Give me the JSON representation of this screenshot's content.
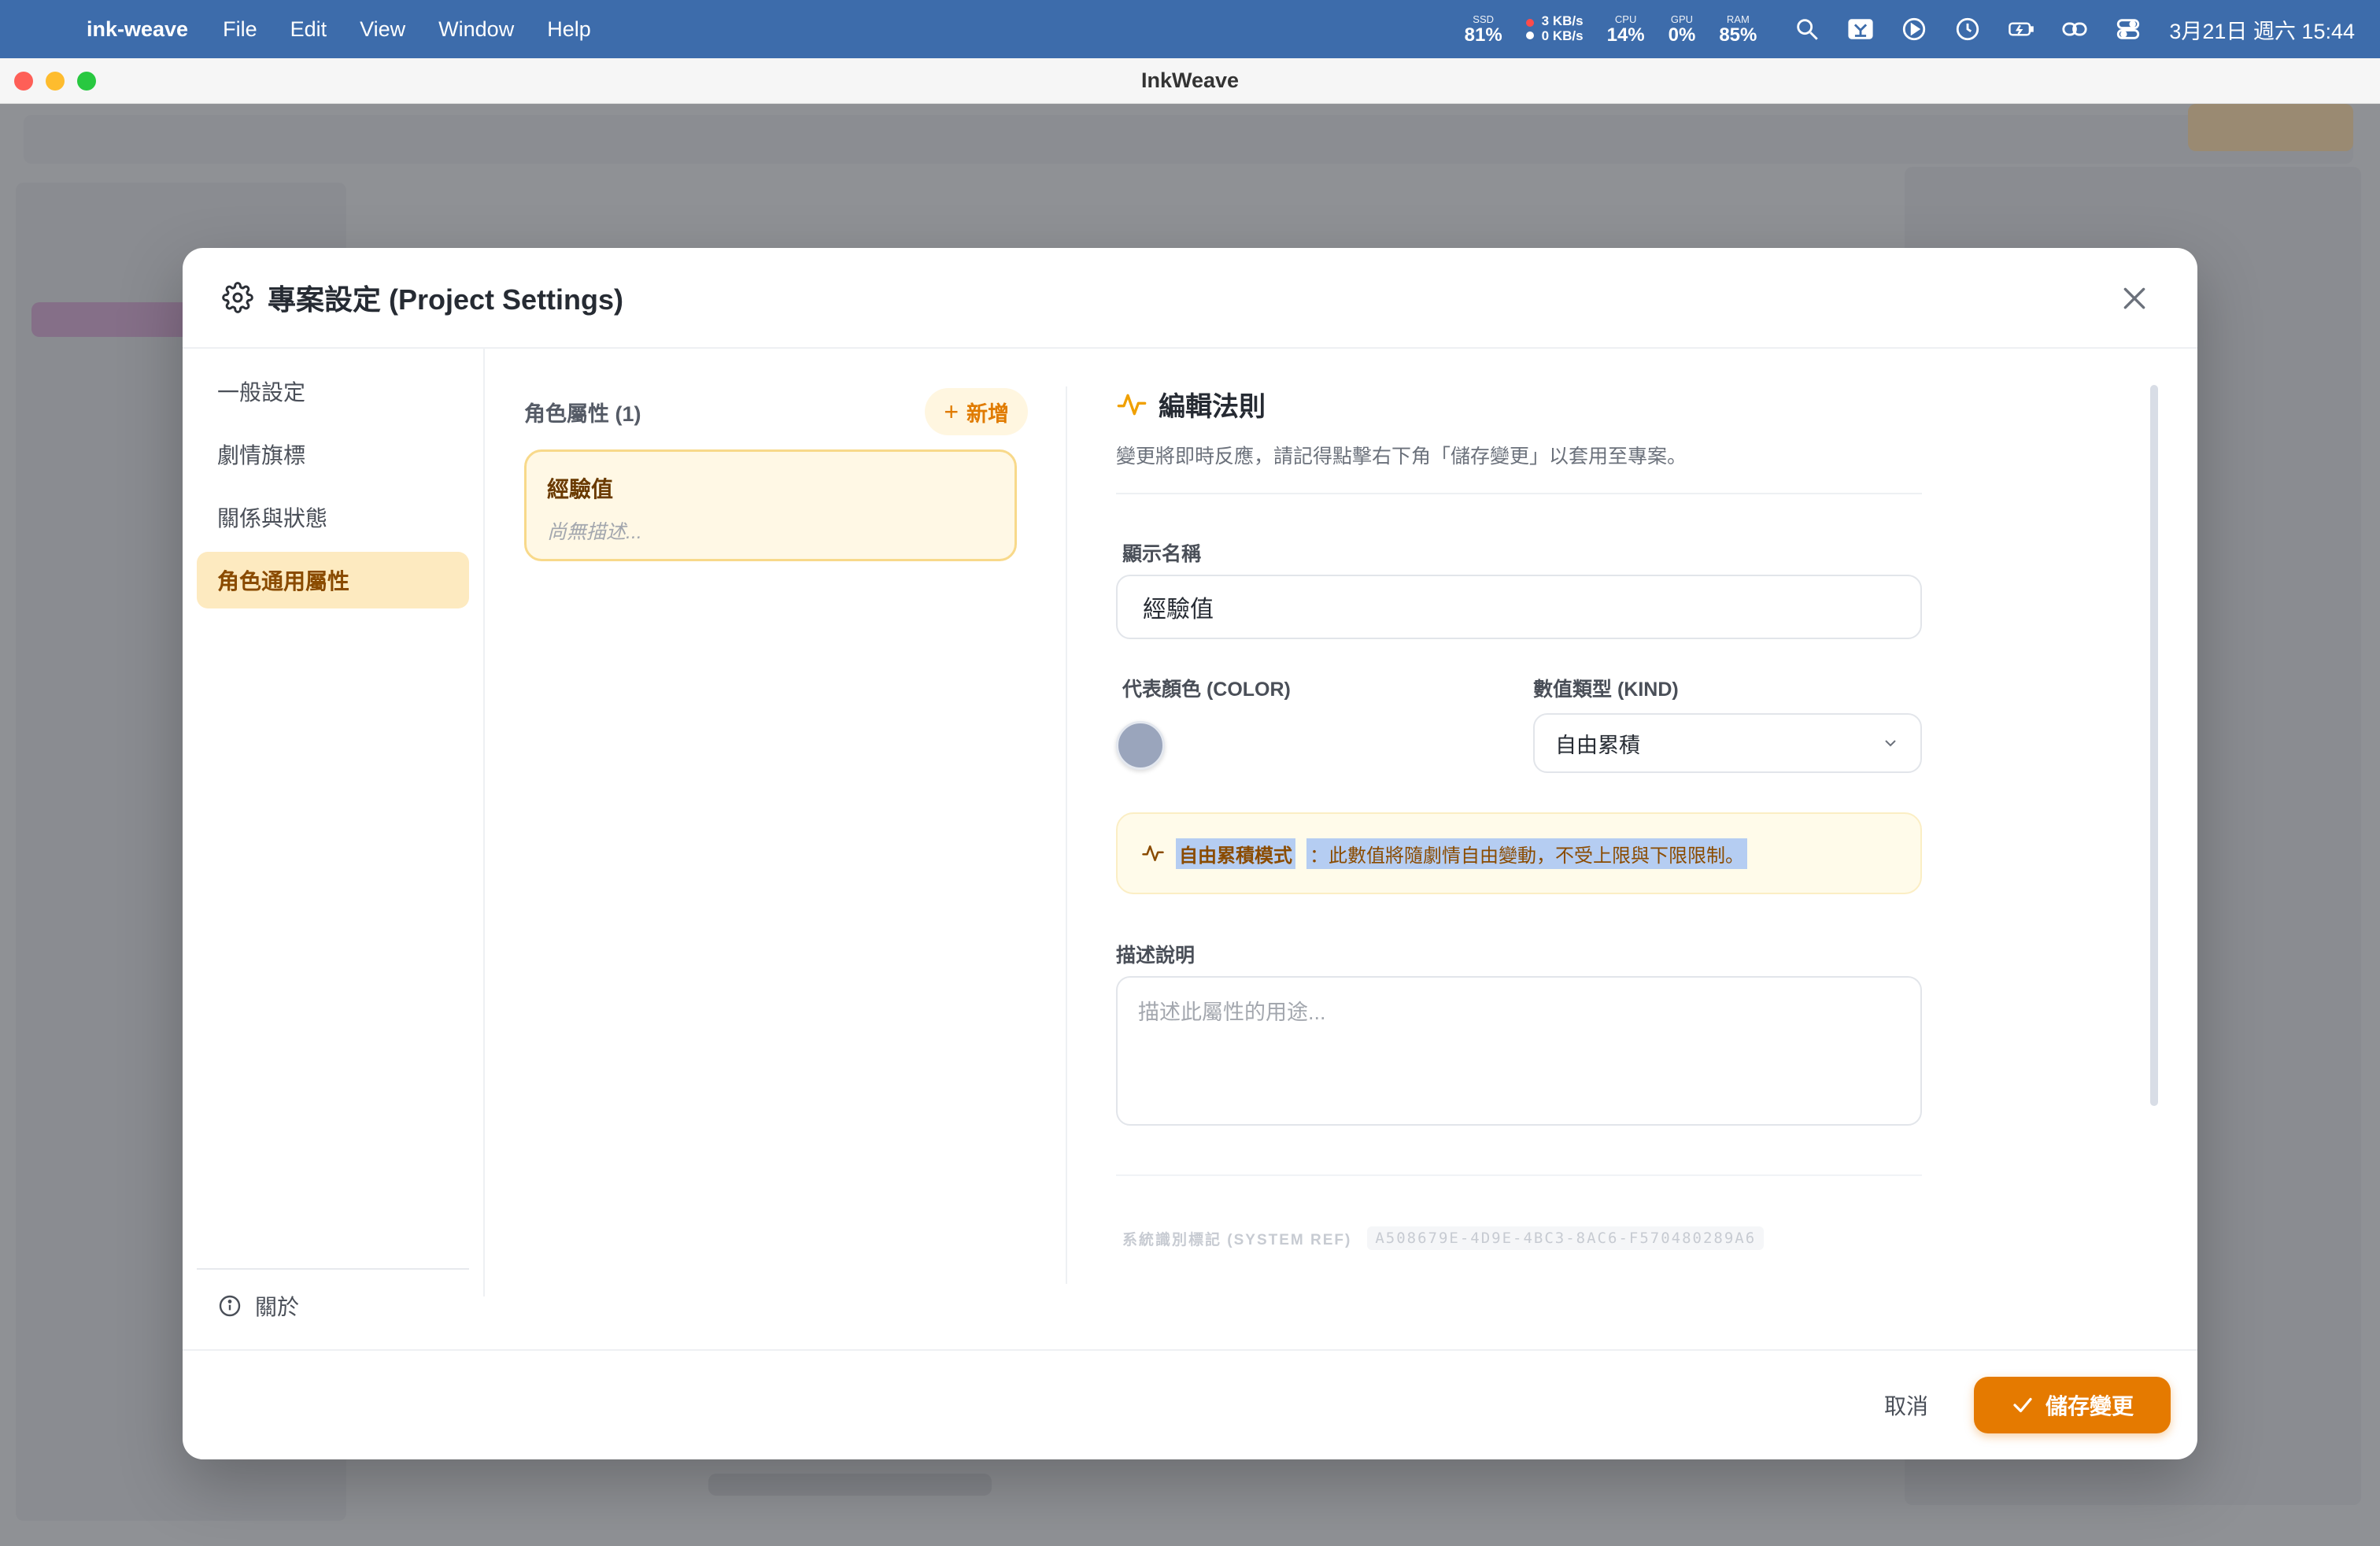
{
  "menubar": {
    "app_name": "ink-weave",
    "menus": [
      "File",
      "Edit",
      "View",
      "Window",
      "Help"
    ],
    "stats": {
      "ssd_label": "SSD",
      "ssd_value": "81%",
      "net_up": "3 KB/s",
      "net_down": "0 KB/s",
      "cpu_label": "CPU",
      "cpu_value": "14%",
      "gpu_label": "GPU",
      "gpu_value": "0%",
      "ram_label": "RAM",
      "ram_value": "85%"
    },
    "clock": "3月21日 週六 15:44"
  },
  "window": {
    "title": "InkWeave"
  },
  "modal": {
    "title": "專案設定 (Project Settings)",
    "nav": [
      {
        "label": "一般設定",
        "active": false
      },
      {
        "label": "劇情旗標",
        "active": false
      },
      {
        "label": "關係與狀態",
        "active": false
      },
      {
        "label": "角色通用屬性",
        "active": true
      }
    ],
    "about_label": "關於",
    "list": {
      "title": "角色屬性 (1)",
      "add_label": "新增",
      "items": [
        {
          "name": "經驗值",
          "desc": "尚無描述..."
        }
      ]
    },
    "editor": {
      "title": "編輯法則",
      "subtitle": "變更將即時反應，請記得點擊右下角「儲存變更」以套用至專案。",
      "name_label": "顯示名稱",
      "name_value": "經驗值",
      "color_label": "代表顏色 (COLOR)",
      "color_value": "#9aa5bc",
      "kind_label": "數值類型 (KIND)",
      "kind_value": "自由累積",
      "hint_title": "自由累積模式",
      "hint_text": "：此數值將隨劇情自由變動，不受上限與下限限制。",
      "desc_label": "描述說明",
      "desc_placeholder": "描述此屬性的用途...",
      "sysref_label": "系統識別標記 (SYSTEM REF)",
      "sysref_value": "A508679E-4D9E-4BC3-8AC6-F570480289A6"
    },
    "footer": {
      "cancel_label": "取消",
      "save_label": "儲存變更"
    }
  },
  "colors": {
    "accent": "#e57a00",
    "menubar": "#3d6cab",
    "active_nav_bg": "#fdeac0"
  }
}
